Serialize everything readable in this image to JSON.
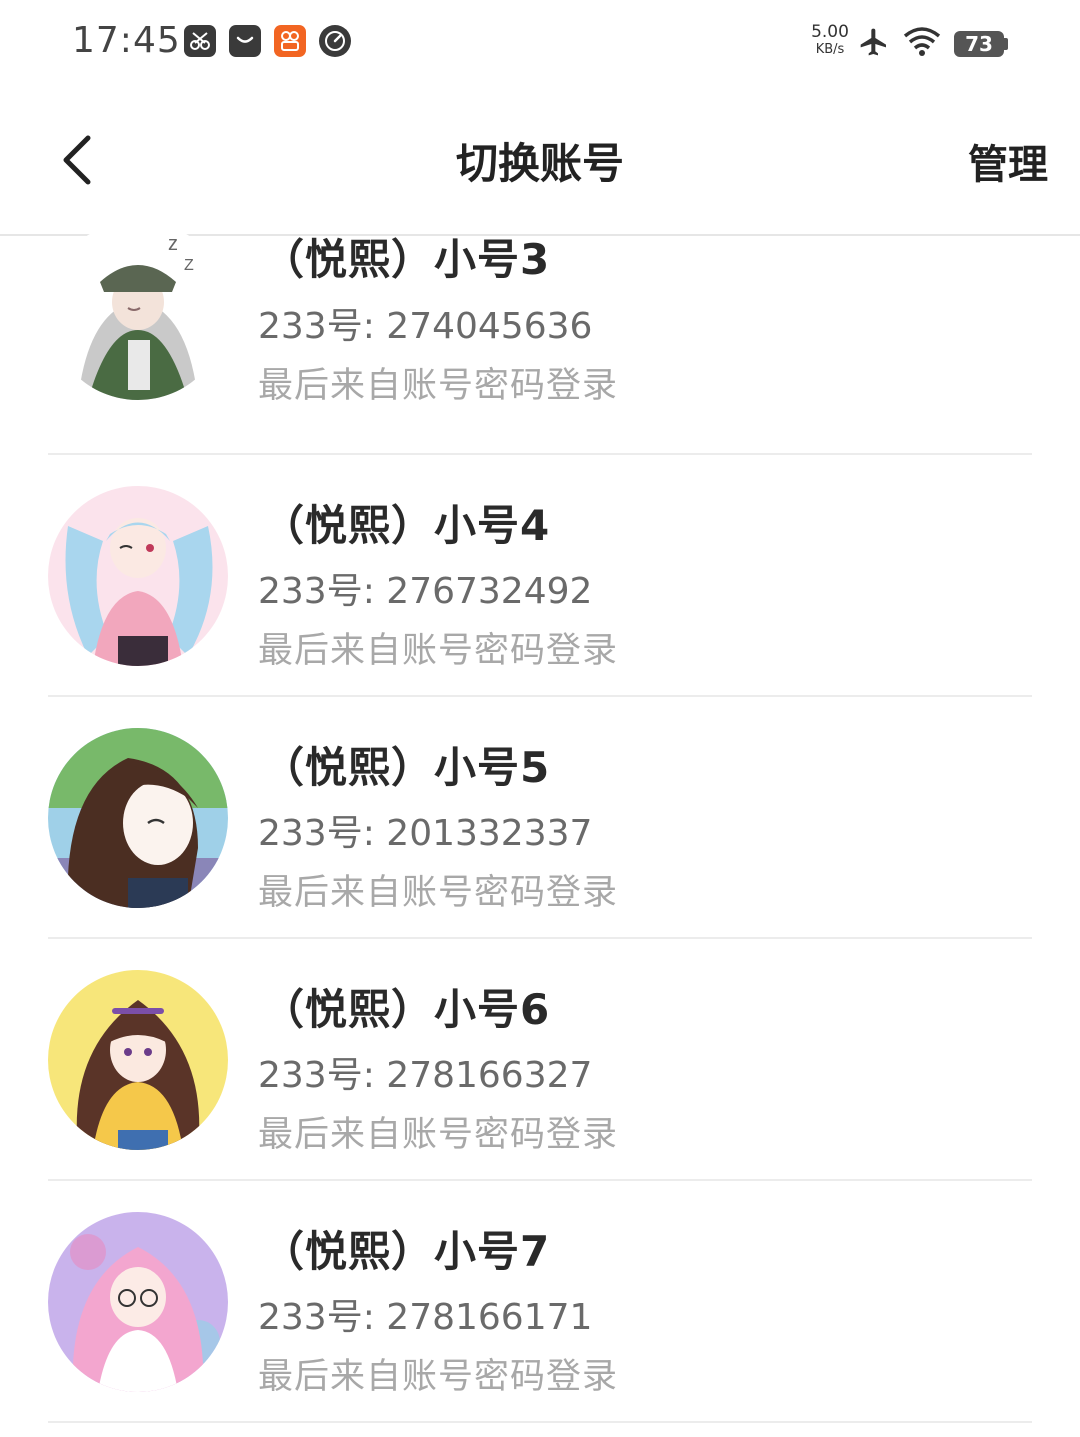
{
  "status_bar": {
    "time": "17:45",
    "app_icons": [
      "scissors-app-icon",
      "bag-app-icon",
      "video-app-icon",
      "gauge-app-icon"
    ],
    "net_speed_value": "5.00",
    "net_speed_unit": "KB/s",
    "battery": "73"
  },
  "header": {
    "title": "切换账号",
    "manage_label": "管理"
  },
  "accounts": [
    {
      "name": "（悦熙）小号3",
      "id_label": "233号: 274045636",
      "login_note": "最后来自账号密码登录"
    },
    {
      "name": "（悦熙）小号4",
      "id_label": "233号: 276732492",
      "login_note": "最后来自账号密码登录"
    },
    {
      "name": "（悦熙）小号5",
      "id_label": "233号: 201332337",
      "login_note": "最后来自账号密码登录"
    },
    {
      "name": "（悦熙）小号6",
      "id_label": "233号: 278166327",
      "login_note": "最后来自账号密码登录"
    },
    {
      "name": "（悦熙）小号7",
      "id_label": "233号: 278166171",
      "login_note": "最后来自账号密码登录"
    }
  ]
}
